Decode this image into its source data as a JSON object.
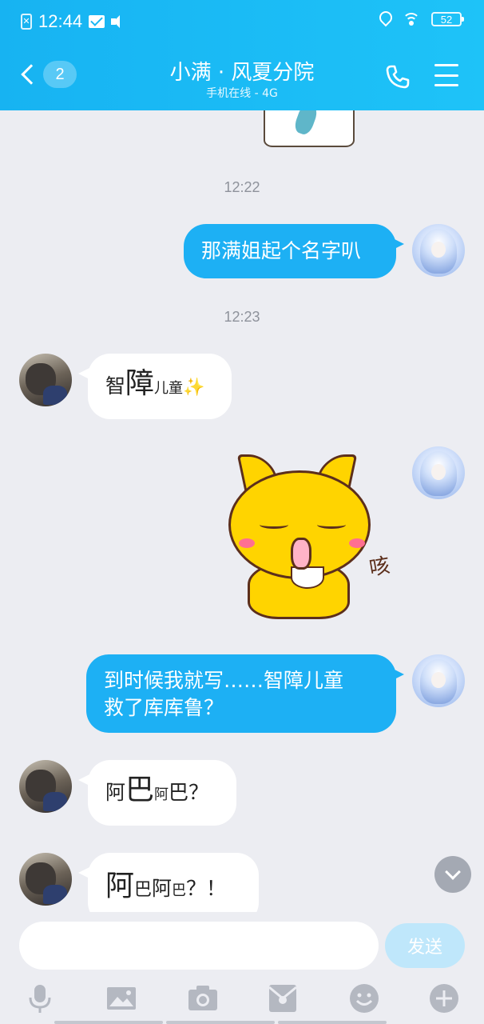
{
  "status_bar": {
    "time": "12:44",
    "battery": "52"
  },
  "header": {
    "back_count": "2",
    "title": "小满 · 风夏分院",
    "subtitle": "手机在线 - 4G"
  },
  "messages": {
    "ts1": "12:22",
    "m1": "那满姐起个名字叭",
    "ts2": "12:23",
    "m2": {
      "a": "智",
      "b": "障",
      "c": "儿童",
      "d": "✨"
    },
    "m3_sticker_text": "咳",
    "m4": {
      "line1": "到时候我就写……智障儿童",
      "line2": "救了库库鲁？"
    },
    "m5": {
      "a": "阿",
      "b": "巴",
      "c": "阿",
      "d": "巴？"
    },
    "m6": {
      "a": "阿",
      "b": "巴",
      "c": "阿",
      "d": "巴",
      "e": "？！"
    }
  },
  "input": {
    "value": "",
    "placeholder": "",
    "send_label": "发送"
  },
  "toolbar": {
    "icons": [
      "microphone-icon",
      "image-icon",
      "camera-icon",
      "red-packet-icon",
      "emoji-icon",
      "plus-icon"
    ]
  },
  "colors": {
    "header_start": "#17b3f2",
    "header_end": "#1ec3f8",
    "bubble_out": "#1db0f4",
    "bubble_in": "#ffffff",
    "chat_bg": "#ecedf2",
    "send_disabled": "#bfe7fb"
  }
}
